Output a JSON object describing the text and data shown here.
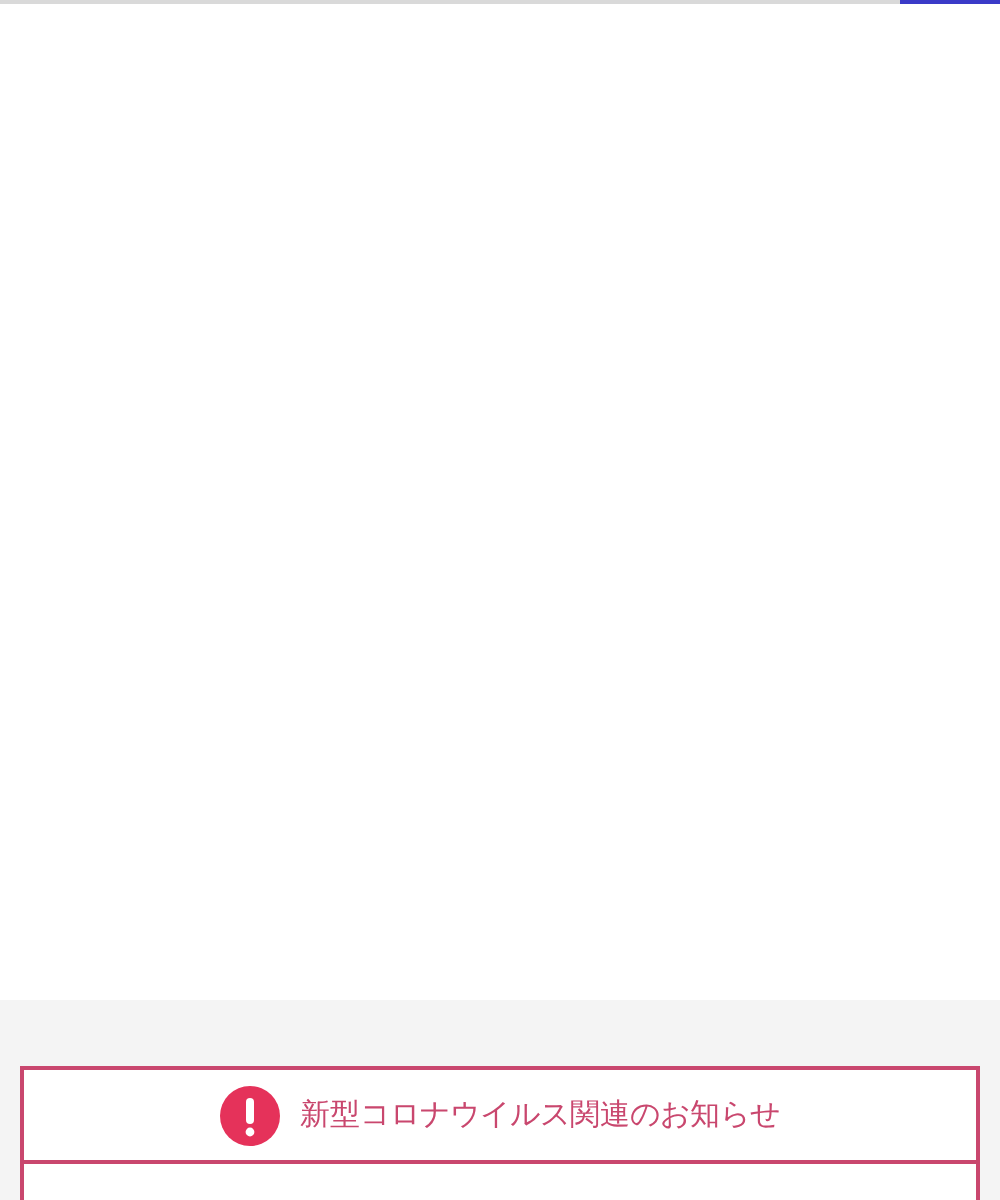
{
  "notice": {
    "title": "新型コロナウイルス関連のお知らせ"
  }
}
